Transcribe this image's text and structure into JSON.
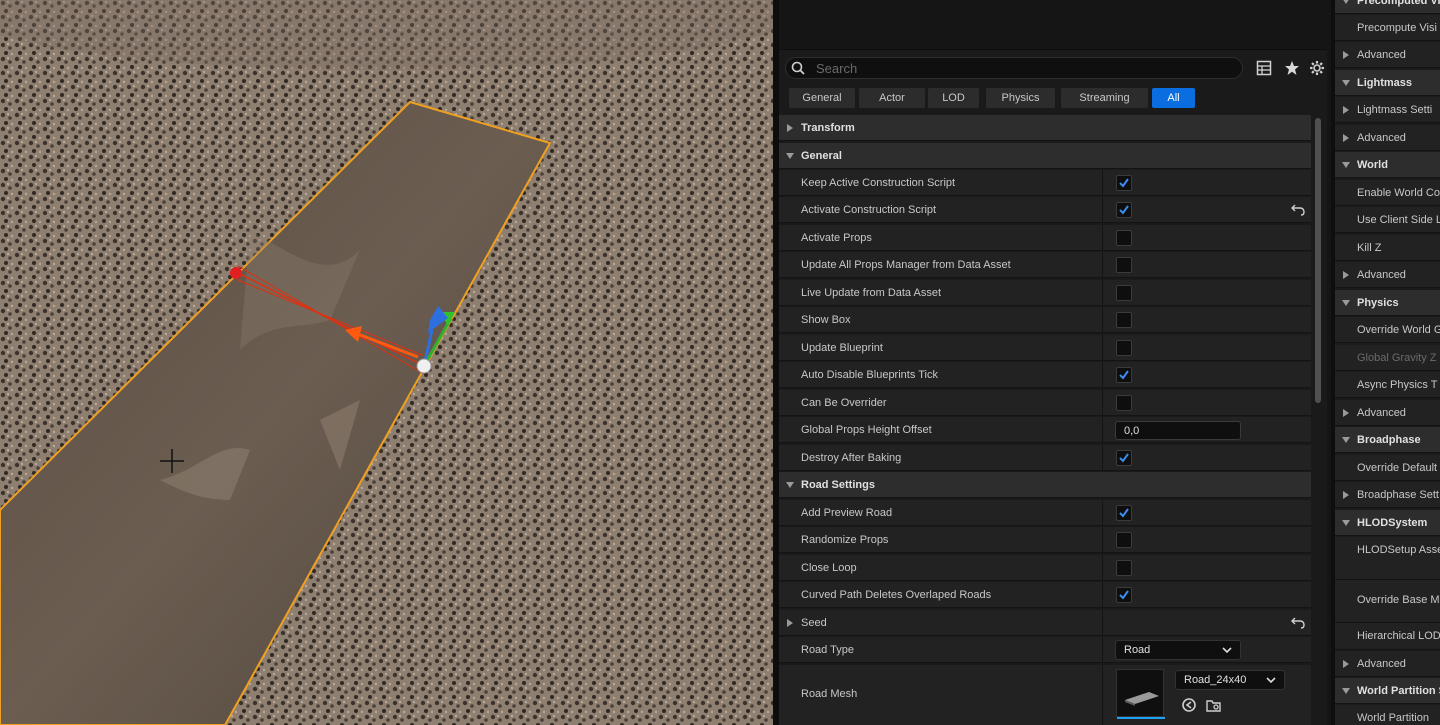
{
  "details": {
    "search_placeholder": "Search",
    "tabs": [
      "General",
      "Actor",
      "LOD",
      "Physics",
      "Streaming",
      "All"
    ],
    "active_tab": "All",
    "sections": {
      "transform": "Transform",
      "general": "General",
      "road_settings": "Road Settings"
    },
    "general_props": [
      {
        "label": "Keep Active Construction Script",
        "checked": true
      },
      {
        "label": "Activate Construction Script",
        "checked": true
      },
      {
        "label": "Activate Props",
        "checked": false
      },
      {
        "label": "Update All Props Manager from Data Asset",
        "checked": false
      },
      {
        "label": "Live Update from Data Asset",
        "checked": false
      },
      {
        "label": "Show Box",
        "checked": false
      },
      {
        "label": "Update Blueprint",
        "checked": false
      },
      {
        "label": "Auto Disable Blueprints Tick",
        "checked": true
      },
      {
        "label": "Can Be Overrider",
        "checked": false
      },
      {
        "label": "Global Props Height Offset",
        "value": "0,0"
      },
      {
        "label": "Destroy After Baking",
        "checked": true
      }
    ],
    "road_props": [
      {
        "label": "Add Preview Road",
        "checked": true
      },
      {
        "label": "Randomize Props",
        "checked": false
      },
      {
        "label": "Close Loop",
        "checked": false
      },
      {
        "label": "Curved Path Deletes Overlaped  Roads",
        "checked": true
      },
      {
        "label": "Seed"
      },
      {
        "label": "Road Type",
        "value": "Road"
      },
      {
        "label": "Road Mesh",
        "value": "Road_24x40"
      }
    ]
  },
  "world_settings": [
    {
      "label": "Precomputed Vis",
      "type": "cat"
    },
    {
      "label": "Precompute Visi",
      "type": "item"
    },
    {
      "label": "Advanced",
      "type": "sub"
    },
    {
      "label": "Lightmass",
      "type": "cat"
    },
    {
      "label": "Lightmass Setti",
      "type": "sub"
    },
    {
      "label": "Advanced",
      "type": "sub"
    },
    {
      "label": "World",
      "type": "cat"
    },
    {
      "label": "Enable World Co",
      "type": "item"
    },
    {
      "label": "Use Client Side L",
      "type": "item"
    },
    {
      "label": "Kill Z",
      "type": "item"
    },
    {
      "label": "Advanced",
      "type": "sub"
    },
    {
      "label": "Physics",
      "type": "cat"
    },
    {
      "label": "Override World G",
      "type": "item"
    },
    {
      "label": "Global Gravity Z",
      "type": "dim"
    },
    {
      "label": "Async Physics T",
      "type": "item"
    },
    {
      "label": "Advanced",
      "type": "sub"
    },
    {
      "label": "Broadphase",
      "type": "cat"
    },
    {
      "label": "Override Default",
      "type": "item"
    },
    {
      "label": "Broadphase Sett",
      "type": "sub"
    },
    {
      "label": "HLODSystem",
      "type": "cat"
    },
    {
      "label": "HLODSetup Asse",
      "type": "item"
    },
    {
      "label": "Override Base M",
      "type": "item"
    },
    {
      "label": "Hierarchical LOD",
      "type": "item"
    },
    {
      "label": "Advanced",
      "type": "sub"
    },
    {
      "label": "World Partition S",
      "type": "cat"
    },
    {
      "label": "World Partition",
      "type": "item"
    }
  ]
}
